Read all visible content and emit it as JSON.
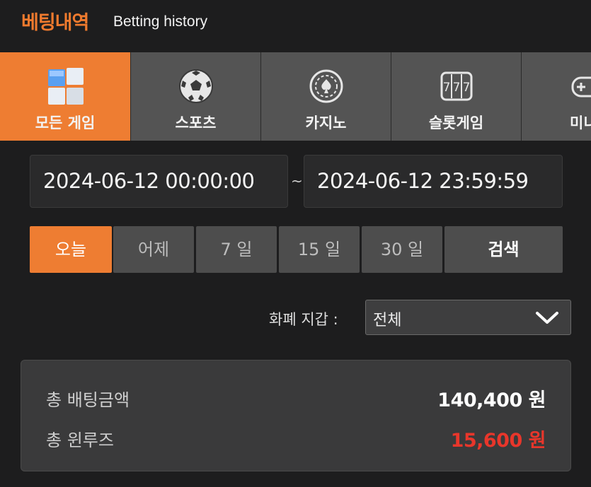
{
  "header": {
    "title": "베팅내역",
    "subtitle": "Betting history"
  },
  "tabs": [
    {
      "label": "모든 게임",
      "icon": "all-games-icon",
      "active": true
    },
    {
      "label": "스포츠",
      "icon": "soccer-ball-icon",
      "active": false
    },
    {
      "label": "카지노",
      "icon": "casino-chip-icon",
      "active": false
    },
    {
      "label": "슬롯게임",
      "icon": "slot-machine-icon",
      "active": false
    },
    {
      "label": "미니",
      "icon": "gamepad-icon",
      "active": false
    }
  ],
  "date_range": {
    "start": "2024-06-12 00:00:00",
    "separator": "~",
    "end": "2024-06-12 23:59:59"
  },
  "quick_filters": [
    {
      "label": "오늘",
      "active": true
    },
    {
      "label": "어제",
      "active": false
    },
    {
      "label": "7 일",
      "active": false
    },
    {
      "label": "15 일",
      "active": false
    },
    {
      "label": "30 일",
      "active": false
    }
  ],
  "search_label": "검색",
  "currency": {
    "label": "화폐 지갑 :",
    "selected": "전체"
  },
  "summary": {
    "total_bet_label": "총 배팅금액",
    "total_bet_value": "140,400 원",
    "total_winloss_label": "총 윈루즈",
    "total_winloss_value": "15,600 원"
  },
  "colors": {
    "accent": "#ee7d32",
    "background": "#1d1d1e",
    "loss_red": "#e8362b",
    "value_white": "#ffffff"
  }
}
